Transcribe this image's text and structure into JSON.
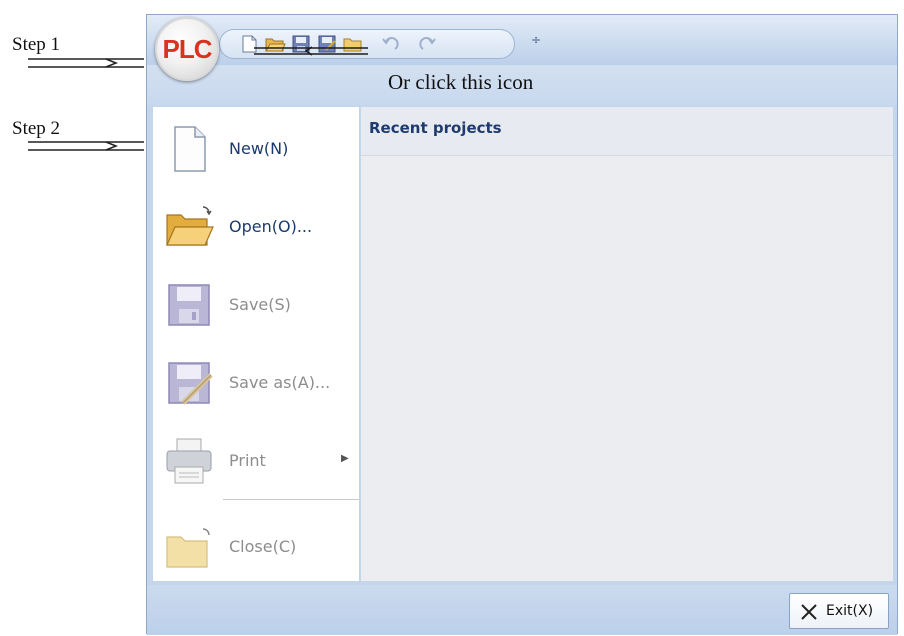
{
  "annotations": {
    "step1": "Step 1",
    "step2": "Step 2",
    "caption": "Or click this icon"
  },
  "app": {
    "orb_text": "PLC"
  },
  "quick_access": {
    "buttons": [
      "new-file-icon",
      "open-folder-icon",
      "save-icon",
      "save-as-icon",
      "folder-icon",
      "undo-icon",
      "redo-icon"
    ],
    "dropdown_glyph": "÷"
  },
  "menu": {
    "items": [
      {
        "label": "New(N)",
        "icon": "new-document-icon",
        "enabled": true
      },
      {
        "label": "Open(O)...",
        "icon": "open-folder-icon",
        "enabled": true
      },
      {
        "label": "Save(S)",
        "icon": "save-icon",
        "enabled": false
      },
      {
        "label": "Save as(A)...",
        "icon": "save-as-icon",
        "enabled": false
      },
      {
        "label": "Print",
        "icon": "printer-icon",
        "enabled": false,
        "submenu": true
      },
      {
        "label": "Close(C)",
        "icon": "close-folder-icon",
        "enabled": false
      }
    ],
    "submenu_glyph": "▶"
  },
  "recent": {
    "title": "Recent projects"
  },
  "footer": {
    "exit_label": "Exit(X)"
  },
  "colors": {
    "accent": "#1b3a6c",
    "orb_text": "#d8331e",
    "frame": "#c4d6ec"
  }
}
